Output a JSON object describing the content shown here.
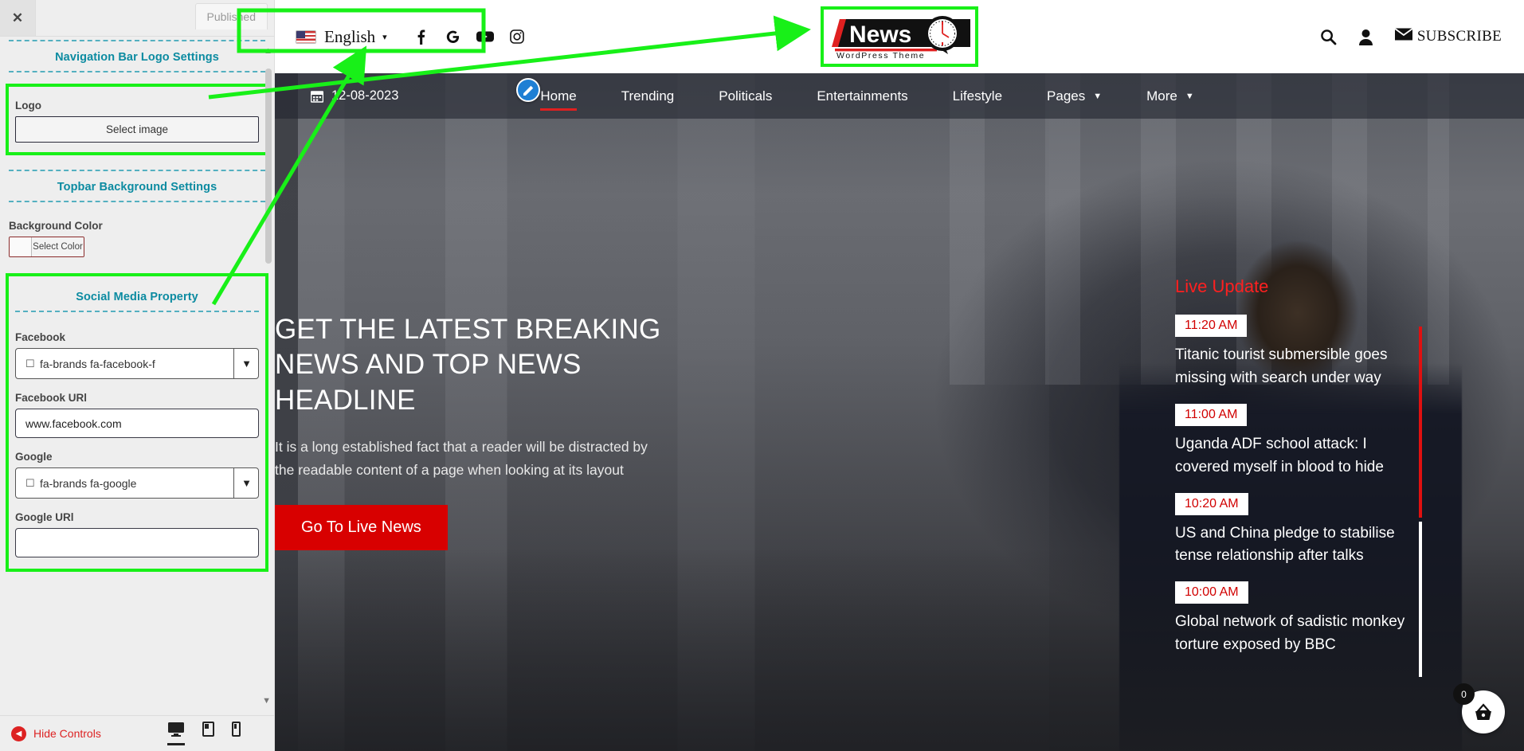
{
  "customizer": {
    "close_icon": "close-icon",
    "published_label": "Published",
    "sections": [
      {
        "title": "Navigation Bar Logo Settings"
      },
      {
        "title": "Topbar Background Settings"
      },
      {
        "title": "Social Media Property"
      }
    ],
    "logo": {
      "label": "Logo",
      "button_label": "Select image"
    },
    "background_color": {
      "label": "Background Color",
      "button_label": "Select Color",
      "swatch_hex": "#ffffff"
    },
    "social": {
      "facebook_label": "Facebook",
      "facebook_icon_value": "fa-brands fa-facebook-f",
      "facebook_url_label": "Facebook URl",
      "facebook_url_value": "www.facebook.com",
      "google_label": "Google",
      "google_icon_value": "fa-brands fa-google",
      "google_url_label": "Google URl",
      "google_url_value": ""
    },
    "footer": {
      "hide_controls_label": "Hide Controls",
      "devices": [
        "desktop",
        "tablet",
        "mobile"
      ],
      "active_device": "desktop"
    }
  },
  "preview": {
    "topbar": {
      "language": "English",
      "language_caret": "▾",
      "social_icons": [
        "facebook-icon",
        "google-icon",
        "youtube-icon",
        "instagram-icon"
      ],
      "logo": {
        "primary_text": "News",
        "secondary_text": "WordPress Theme",
        "accent_hex": "#e02020"
      },
      "right_icons": [
        "search-icon",
        "account-icon"
      ],
      "subscribe_label": "SUBSCRIBE"
    },
    "nav": {
      "date": "12-08-2023",
      "items": [
        {
          "label": "Home",
          "active": true,
          "has_caret": false
        },
        {
          "label": "Trending",
          "active": false,
          "has_caret": false
        },
        {
          "label": "Politicals",
          "active": false,
          "has_caret": false
        },
        {
          "label": "Entertainments",
          "active": false,
          "has_caret": false
        },
        {
          "label": "Lifestyle",
          "active": false,
          "has_caret": false
        },
        {
          "label": "Pages",
          "active": false,
          "has_caret": true
        },
        {
          "label": "More",
          "active": false,
          "has_caret": true
        }
      ],
      "active_accent_hex": "#e02020"
    },
    "hero": {
      "title": "GET THE LATEST BREAKING NEWS AND TOP NEWS HEADLINE",
      "subtitle": "It is a long established fact that a reader will be distracted by the readable content of a page when looking at its layout",
      "cta_label": "Go To Live News",
      "cta_hex": "#d80000"
    },
    "live_update": {
      "title": "Live Update",
      "title_hex": "#ff2020",
      "items": [
        {
          "time": "11:20 AM",
          "headline": "Titanic tourist submersible goes missing with search under way"
        },
        {
          "time": "11:00 AM",
          "headline": "Uganda ADF school attack: I covered myself in blood to hide"
        },
        {
          "time": "10:20 AM",
          "headline": "US and China pledge to stabilise tense relationship after talks"
        },
        {
          "time": "10:00 AM",
          "headline": "Global network of sadistic monkey torture exposed by BBC"
        }
      ]
    },
    "cart": {
      "count": "0",
      "icon": "shopping-basket-icon"
    }
  }
}
